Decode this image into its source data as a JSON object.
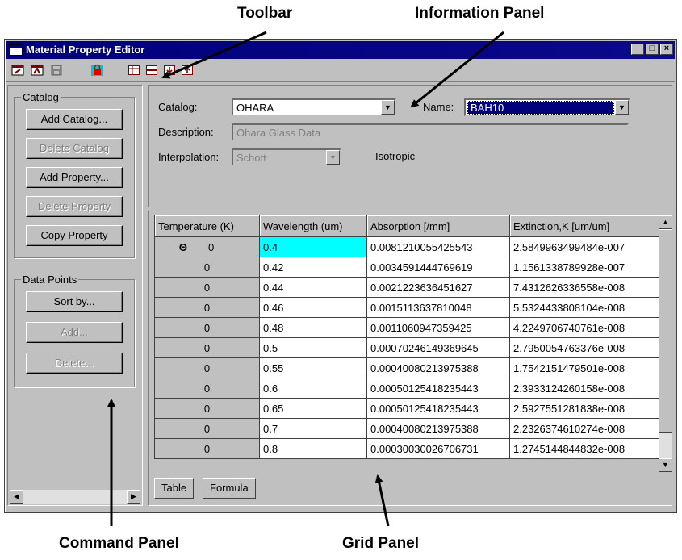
{
  "callouts": {
    "toolbar": "Toolbar",
    "information_panel": "Information Panel",
    "command_panel": "Command Panel",
    "grid_panel": "Grid Panel"
  },
  "window": {
    "title": "Material Property Editor"
  },
  "toolbar": {
    "icons": [
      "catalog-open-icon",
      "catalog-new-icon",
      "save-icon",
      "lock-icon",
      "table-view-icon",
      "split-view-icon",
      "insert-row-icon",
      "delete-row-icon"
    ]
  },
  "command_panel": {
    "catalog_group": {
      "label": "Catalog",
      "buttons": [
        "Add Catalog...",
        "Delete Catalog",
        "Add  Property...",
        "Delete Property",
        "Copy Property"
      ]
    },
    "data_points_group": {
      "label": "Data Points",
      "buttons": [
        "Sort by...",
        "Add...",
        "Delete..."
      ]
    }
  },
  "info_panel": {
    "catalog_label": "Catalog:",
    "catalog_value": "OHARA",
    "name_label": "Name:",
    "name_value": "BAH10",
    "description_label": "Description:",
    "description_value": "Ohara Glass Data",
    "interpolation_label": "Interpolation:",
    "interpolation_value": "Schott",
    "isotropic_text": "Isotropic"
  },
  "grid": {
    "headers": [
      "Temperature (K)",
      "Wavelength (um)",
      "Absorption [/mm]",
      "Extinction,K [um/um]"
    ],
    "selected_marker": "Θ",
    "rows": [
      [
        "0",
        "0.4",
        "0.0081210055425543",
        "2.5849963499484e-007"
      ],
      [
        "0",
        "0.42",
        "0.0034591444769619",
        "1.1561338789928e-007"
      ],
      [
        "0",
        "0.44",
        "0.0021223636451627",
        "7.4312626336558e-008"
      ],
      [
        "0",
        "0.46",
        "0.0015113637810048",
        "5.5324433808104e-008"
      ],
      [
        "0",
        "0.48",
        "0.0011060947359425",
        "4.2249706740761e-008"
      ],
      [
        "0",
        "0.5",
        "0.00070246149369645",
        "2.7950054763376e-008"
      ],
      [
        "0",
        "0.55",
        "0.00040080213975388",
        "1.7542151479501e-008"
      ],
      [
        "0",
        "0.6",
        "0.00050125418235443",
        "2.3933124260158e-008"
      ],
      [
        "0",
        "0.65",
        "0.00050125418235443",
        "2.5927551281838e-008"
      ],
      [
        "0",
        "0.7",
        "0.00040080213975388",
        "2.2326374610274e-008"
      ],
      [
        "0",
        "0.8",
        "0.00030030026706731",
        "1.2745144844832e-008"
      ]
    ],
    "tabs": [
      "Table",
      "Formula"
    ]
  },
  "colors": {
    "titlebar": "#00007b",
    "selection": "#00ffff",
    "face": "#c0c0c0"
  }
}
